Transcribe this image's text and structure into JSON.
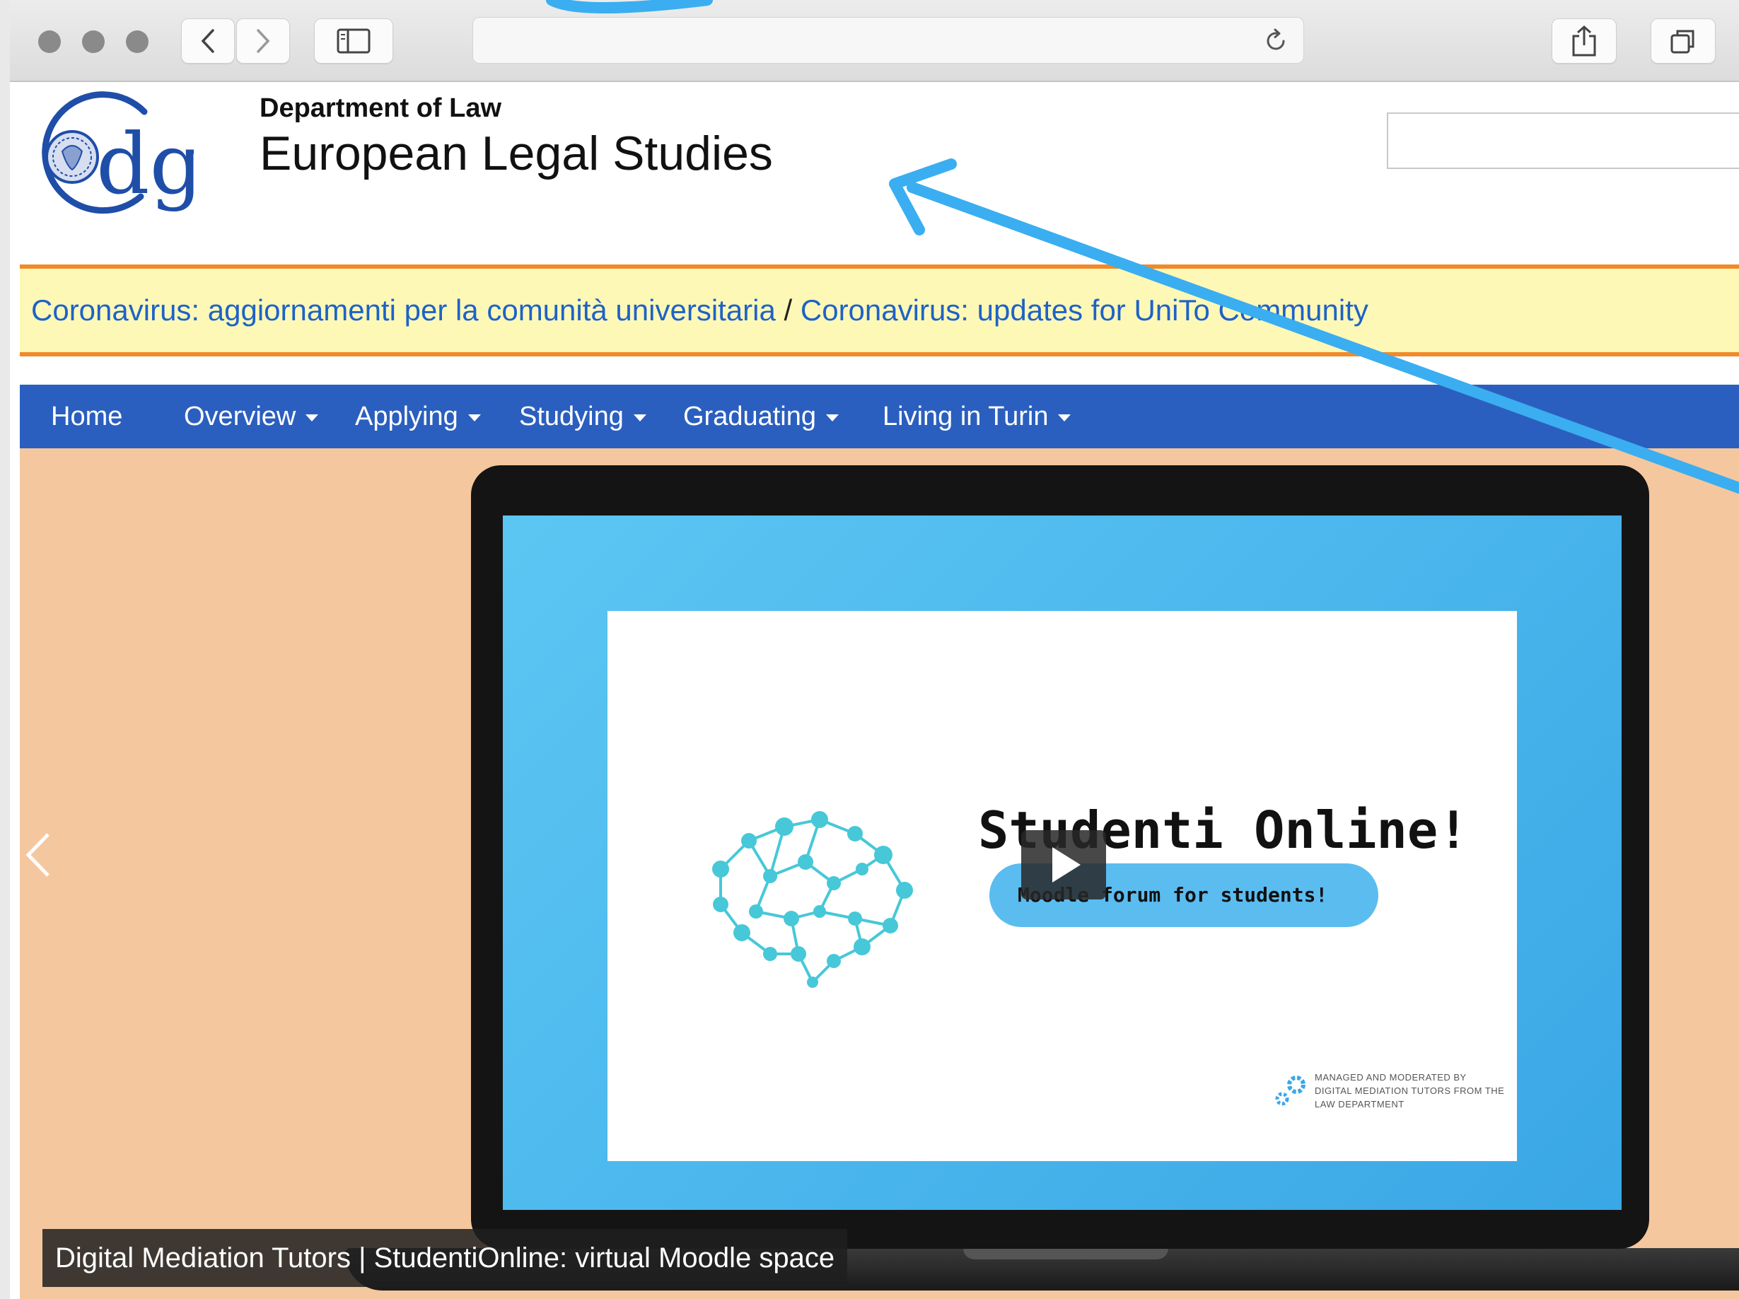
{
  "header": {
    "department": "Department of Law",
    "site_title": "European Legal Studies",
    "logo_text": "dg"
  },
  "notice": {
    "link_it": "Coronavirus: aggiornamenti per la comunità universitaria",
    "separator": " / ",
    "link_en": "Coronavirus: updates for UniTo Community"
  },
  "nav": {
    "items": [
      {
        "label": "Home"
      },
      {
        "label": "Overview"
      },
      {
        "label": "Applying"
      },
      {
        "label": "Studying"
      },
      {
        "label": "Graduating"
      },
      {
        "label": "Living in Turin"
      }
    ]
  },
  "hero": {
    "slide_title": "Studenti Online!",
    "pill_text": "Moodle forum for students!",
    "managed_text": "MANAGED AND MODERATED BY DIGITAL MEDIATION TUTORS FROM THE LAW DEPARTMENT",
    "caption": "Digital Mediation Tutors | StudentiOnline: virtual Moodle space"
  },
  "colors": {
    "nav_bg": "#2b5fbf",
    "notice_bg": "#fdf8b6",
    "notice_border": "#f08a2a",
    "hero_bg": "#f5c79e",
    "link": "#1e62c8",
    "annotation_arrow": "#3aaef0"
  }
}
